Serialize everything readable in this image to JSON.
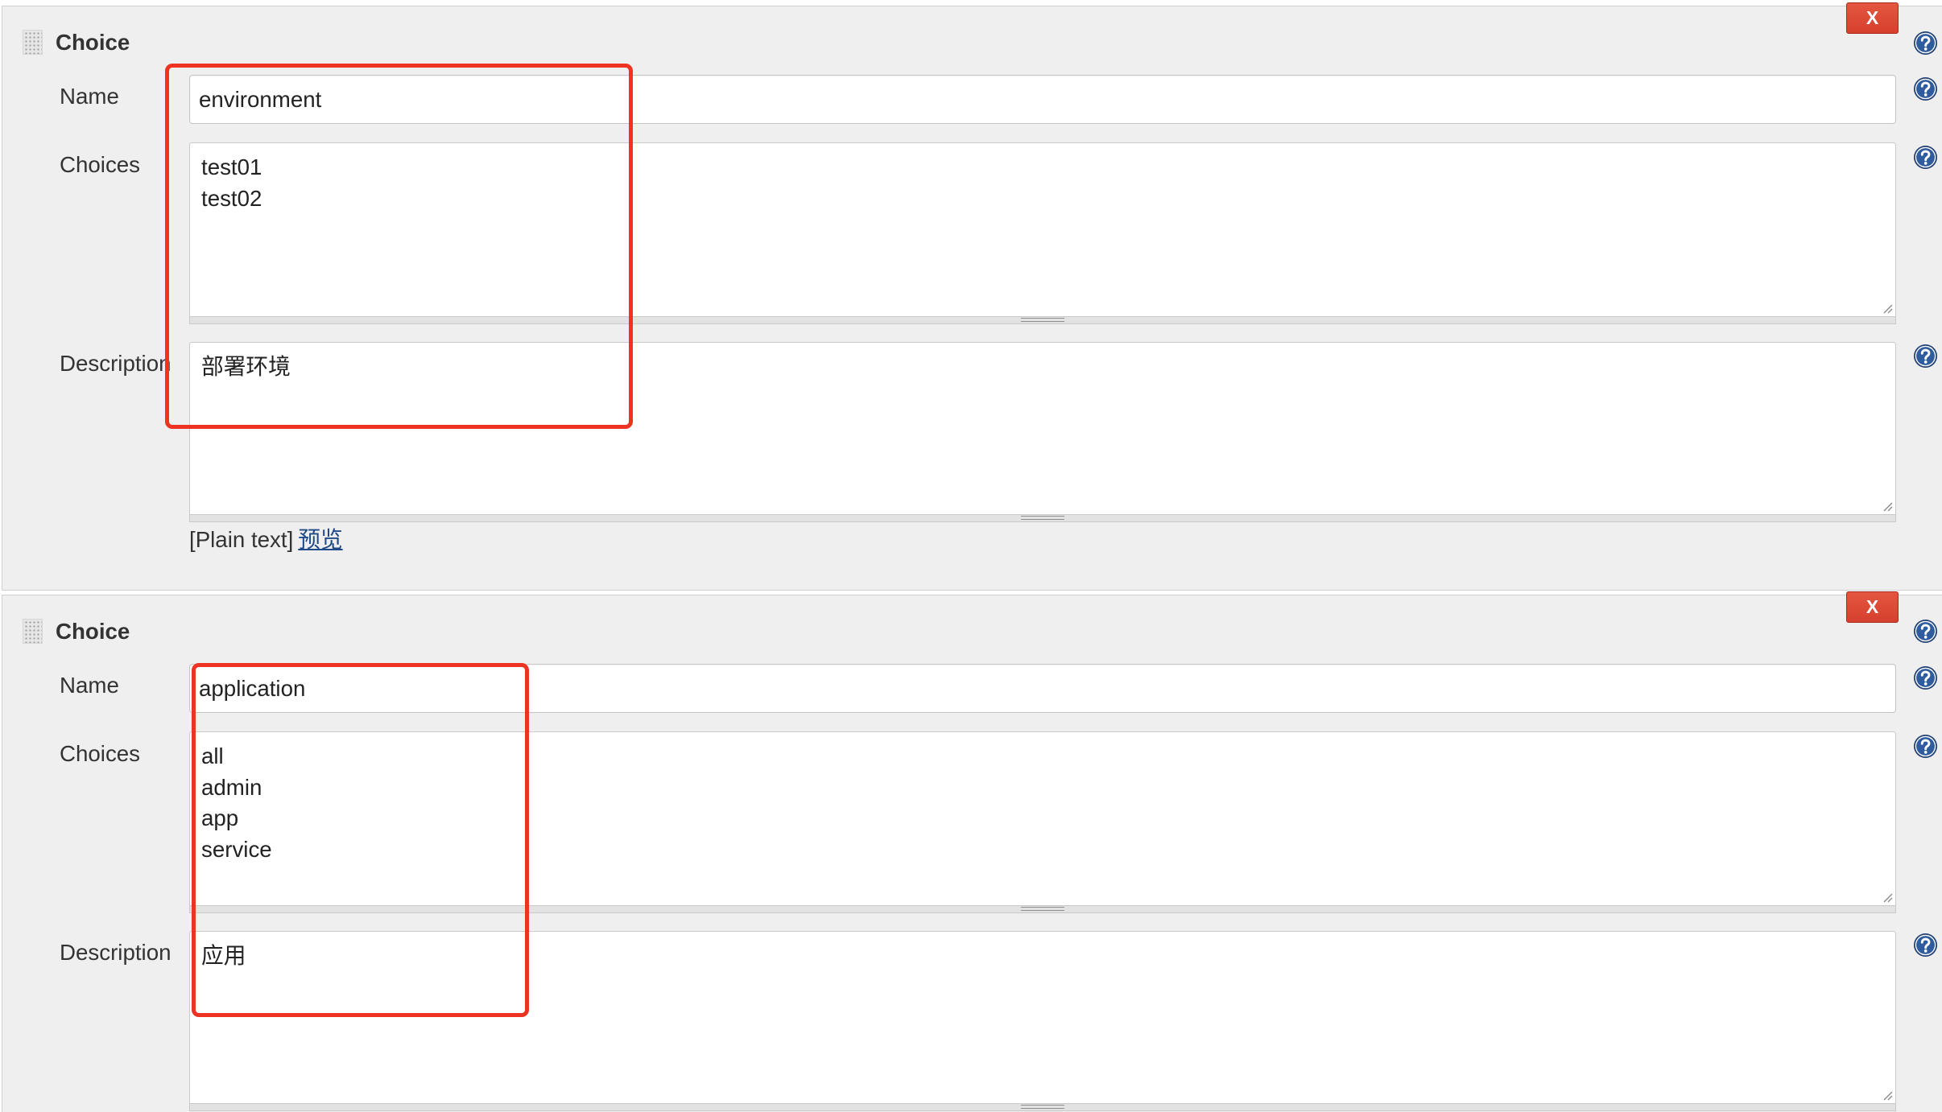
{
  "blocks": [
    {
      "title": "Choice",
      "delete_label": "X",
      "name": {
        "label": "Name",
        "value": "environment"
      },
      "choices": {
        "label": "Choices",
        "value": "test01\ntest02"
      },
      "description": {
        "label": "Description",
        "value": "部署环境"
      },
      "format": {
        "label": "[Plain text]",
        "preview_link": "预览"
      }
    },
    {
      "title": "Choice",
      "delete_label": "X",
      "name": {
        "label": "Name",
        "value": "application"
      },
      "choices": {
        "label": "Choices",
        "value": "all\nadmin\napp\nservice"
      },
      "description": {
        "label": "Description",
        "value": "应用"
      }
    }
  ],
  "icons": {
    "help": "help-icon",
    "drag": "drag-handle-icon",
    "textarea_resize": "resize-corner-icon",
    "grip": "resize-grip-icon"
  },
  "colors": {
    "delete_button": "#d6402e",
    "highlight_box": "#ee3322",
    "link": "#204a87",
    "help_icon": "#2f5c9f",
    "panel_background": "#efefef",
    "label_text": "#333333"
  }
}
